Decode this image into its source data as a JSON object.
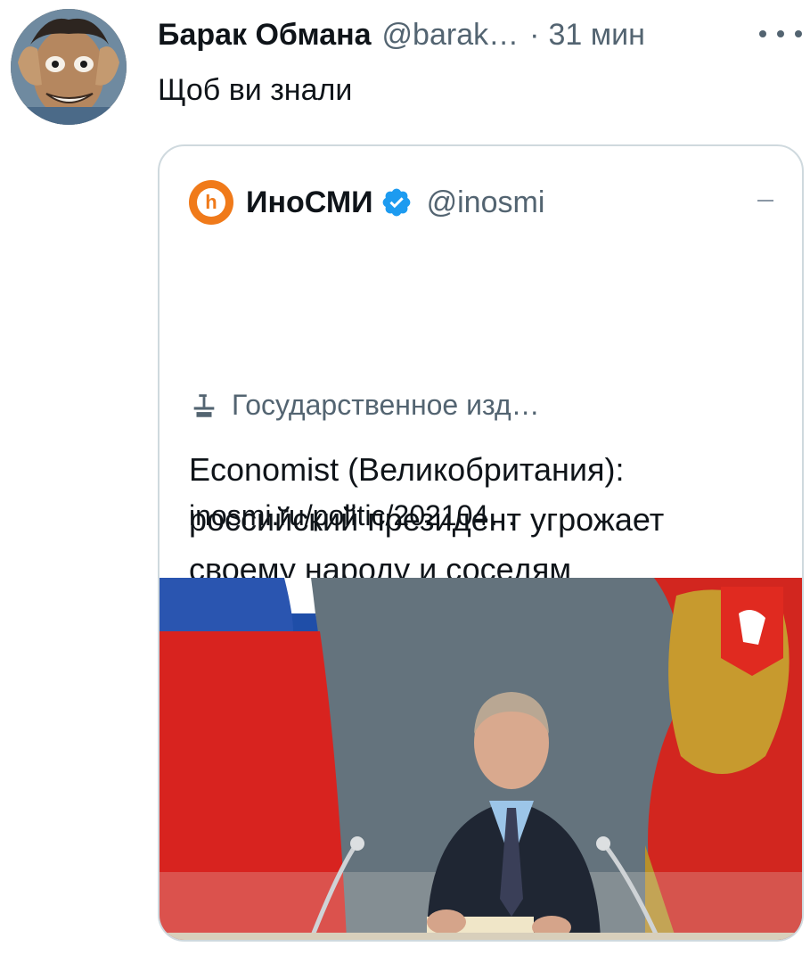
{
  "tweet": {
    "author_name": "Барак Обмана",
    "author_handle": "@barak…",
    "separator": "·",
    "time": "31 мин",
    "text": "Щоб ви знали"
  },
  "quoted": {
    "avatar_letter": "h",
    "author_name": "ИноСМИ",
    "author_handle": "@inosmi",
    "label": "Государственное изд…",
    "body": "Economist (Великобритания): российский президент угрожает своему народу и соседям",
    "link": "inosmi.ru/politic/202104…"
  },
  "colors": {
    "secondary_text": "#536471",
    "verified_blue": "#1d9bf0",
    "inosmi_orange": "#f07a1a",
    "border": "#cfd9de"
  },
  "icons": {
    "more": "more-horizontal-icon",
    "verified": "verified-badge-icon",
    "label": "government-podium-icon"
  }
}
